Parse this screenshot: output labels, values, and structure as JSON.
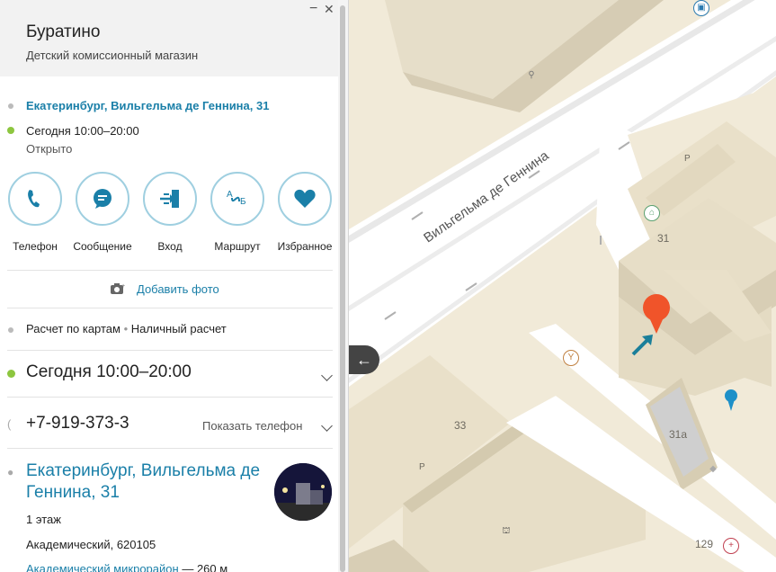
{
  "place": {
    "name": "Буратино",
    "category": "Детский комиссионный магазин"
  },
  "window": {
    "minimize": "−",
    "close": "✕"
  },
  "address_top": "Екатеринбург, Вильгельма де Геннина, 31",
  "hours_top": "Сегодня 10:00–20:00",
  "status": "Открыто",
  "actions": [
    {
      "label": "Телефон",
      "icon": "phone-icon"
    },
    {
      "label": "Сообщение",
      "icon": "message-icon"
    },
    {
      "label": "Вход",
      "icon": "entrance-icon"
    },
    {
      "label": "Маршрут",
      "icon": "route-icon"
    },
    {
      "label": "Избранное",
      "icon": "heart-icon"
    }
  ],
  "add_photo": "Добавить фото",
  "payment": {
    "card": "Расчет по картам",
    "sep": "•",
    "cash": "Наличный расчет"
  },
  "hours_main": "Сегодня 10:00–20:00",
  "phone": {
    "number": "+7-919-373-3",
    "show": "Показать телефон"
  },
  "address_main": {
    "line1": "Екатеринбург, Вильгельма де",
    "line2": "Геннина, 31"
  },
  "floor": "1 этаж",
  "district": "Академический, 620105",
  "nearby": {
    "name": "Академический микрорайон",
    "distance": "— 260 м"
  },
  "map": {
    "street": "Вильгельма де Геннина",
    "labels": {
      "b31": "31",
      "b31a": "31а",
      "b33": "33",
      "b129": "129",
      "parking1": "P",
      "parking2": "P"
    },
    "colors": {
      "pin": "#f0542a",
      "arrow": "#1a7f9a",
      "blue_pin": "#1e90c8"
    }
  }
}
